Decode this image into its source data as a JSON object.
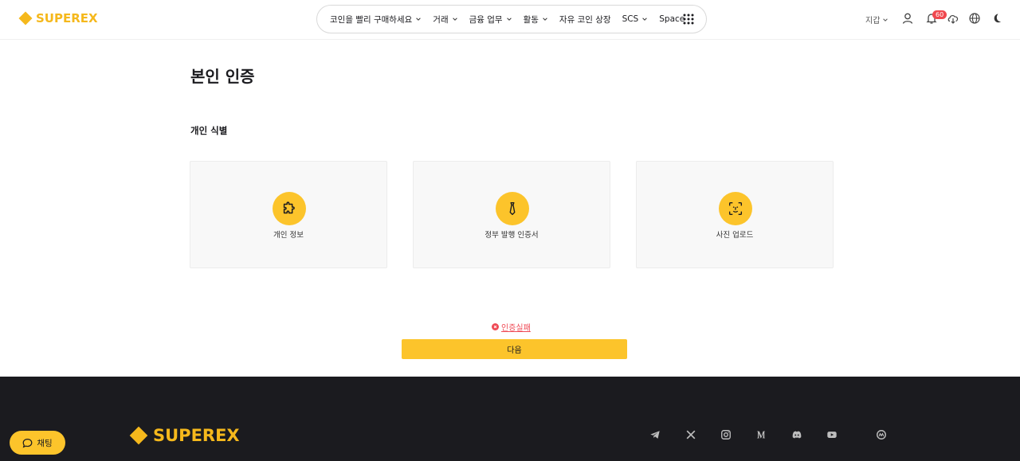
{
  "brand": {
    "name": "SUPEREX",
    "color": "#f5b81c"
  },
  "nav": {
    "items": [
      {
        "label": "코인을 빨리 구매하세요",
        "has_dropdown": true
      },
      {
        "label": "거래",
        "has_dropdown": true
      },
      {
        "label": "금융 업무",
        "has_dropdown": true
      },
      {
        "label": "활동",
        "has_dropdown": true
      },
      {
        "label": "자유 코인 상장",
        "has_dropdown": false
      },
      {
        "label": "SCS",
        "has_dropdown": true
      },
      {
        "label": "Space",
        "has_dropdown": false
      }
    ],
    "apps_icon": "grid-icon"
  },
  "header_right": {
    "wallet_label": "지갑",
    "notification_count": "60",
    "icons": [
      "user-icon",
      "bell-icon",
      "download-icon",
      "globe-icon",
      "moon-icon"
    ]
  },
  "page": {
    "title": "본인 인증",
    "section_title": "개인 식별",
    "cards": [
      {
        "label": "개인 정보",
        "icon": "puzzle-icon"
      },
      {
        "label": "정부 발행 인증서",
        "icon": "tie-icon"
      },
      {
        "label": "사진 업로드",
        "icon": "face-scan-icon"
      }
    ],
    "status_text": "인증실패",
    "next_label": "다음"
  },
  "footer": {
    "brand": "SUPEREX",
    "social_icons": [
      "telegram-icon",
      "x-icon",
      "instagram-icon",
      "medium-icon",
      "discord-icon",
      "youtube-icon",
      "coinmarketcap-icon"
    ]
  },
  "chat": {
    "label": "채팅"
  },
  "colors": {
    "accent": "#fcc42b",
    "error": "#ef4b56",
    "footer_bg": "#1b1b1f"
  }
}
